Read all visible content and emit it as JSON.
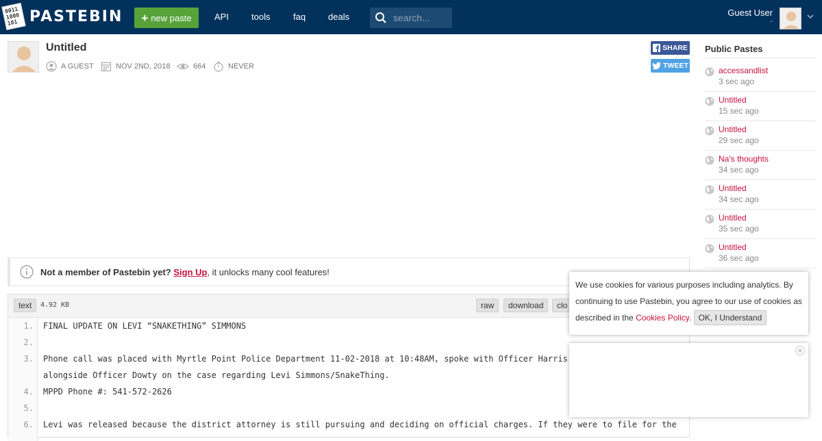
{
  "header": {
    "logo_text": "PASTEBIN",
    "new_paste_label": "new paste",
    "nav": [
      "API",
      "tools",
      "faq",
      "deals"
    ],
    "search_placeholder": "search...",
    "user_name": "Guest User",
    "user_sub": "-"
  },
  "paste": {
    "title": "Untitled",
    "author": "A GUEST",
    "date": "NOV 2ND, 2018",
    "views": "664",
    "expires": "NEVER",
    "share_label": "SHARE",
    "tweet_label": "TWEET"
  },
  "notice": {
    "lead": "Not a member of Pastebin yet?",
    "link": "Sign Up",
    "tail": ", it unlocks many cool features!"
  },
  "code": {
    "syntax": "text",
    "size": "4.92 KB",
    "actions": [
      "raw",
      "download",
      "clone"
    ],
    "actions_visible": [
      "raw",
      "download",
      "clo"
    ],
    "line_numbers": [
      "1.",
      "2.",
      "3.",
      "",
      "4.",
      "5.",
      "6."
    ],
    "lines": [
      "FINAL UPDATE ON LEVI “SNAKETHING” SIMMONS",
      "",
      "Phone call was placed with Myrtle Point Police Department 11-02-2018 at 10:48AM, spoke with Officer Harris",
      "alongside Officer Dowty on the case regarding Levi Simmons/SnakeThing.",
      "MPPD Phone #: 541-572-2626",
      "",
      "Levi was released because the district attorney is still pursuing and deciding on official charges. If they were to file for the"
    ]
  },
  "sidebar": {
    "title": "Public Pastes",
    "items": [
      {
        "title": "accessandlist",
        "time": "3 sec ago"
      },
      {
        "title": "Untitled",
        "time": "15 sec ago"
      },
      {
        "title": "Untitled",
        "time": "29 sec ago"
      },
      {
        "title": "Na's thoughts",
        "time": "34 sec ago"
      },
      {
        "title": "Untitled",
        "time": "34 sec ago"
      },
      {
        "title": "Untitled",
        "time": "35 sec ago"
      },
      {
        "title": "Untitled",
        "time": "36 sec ago"
      }
    ]
  },
  "cookie": {
    "text": "We use cookies for various purposes including analytics. By continuing to use Pastebin, you agree to our use of cookies as described in the ",
    "link": "Cookies Policy",
    "after": ".",
    "button": "OK, I Understand"
  },
  "colors": {
    "header_bg": "#02315c",
    "new_paste_green": "#57a33a",
    "link_red": "#c50f3e",
    "facebook": "#3b5998",
    "twitter": "#4fa2e3"
  }
}
